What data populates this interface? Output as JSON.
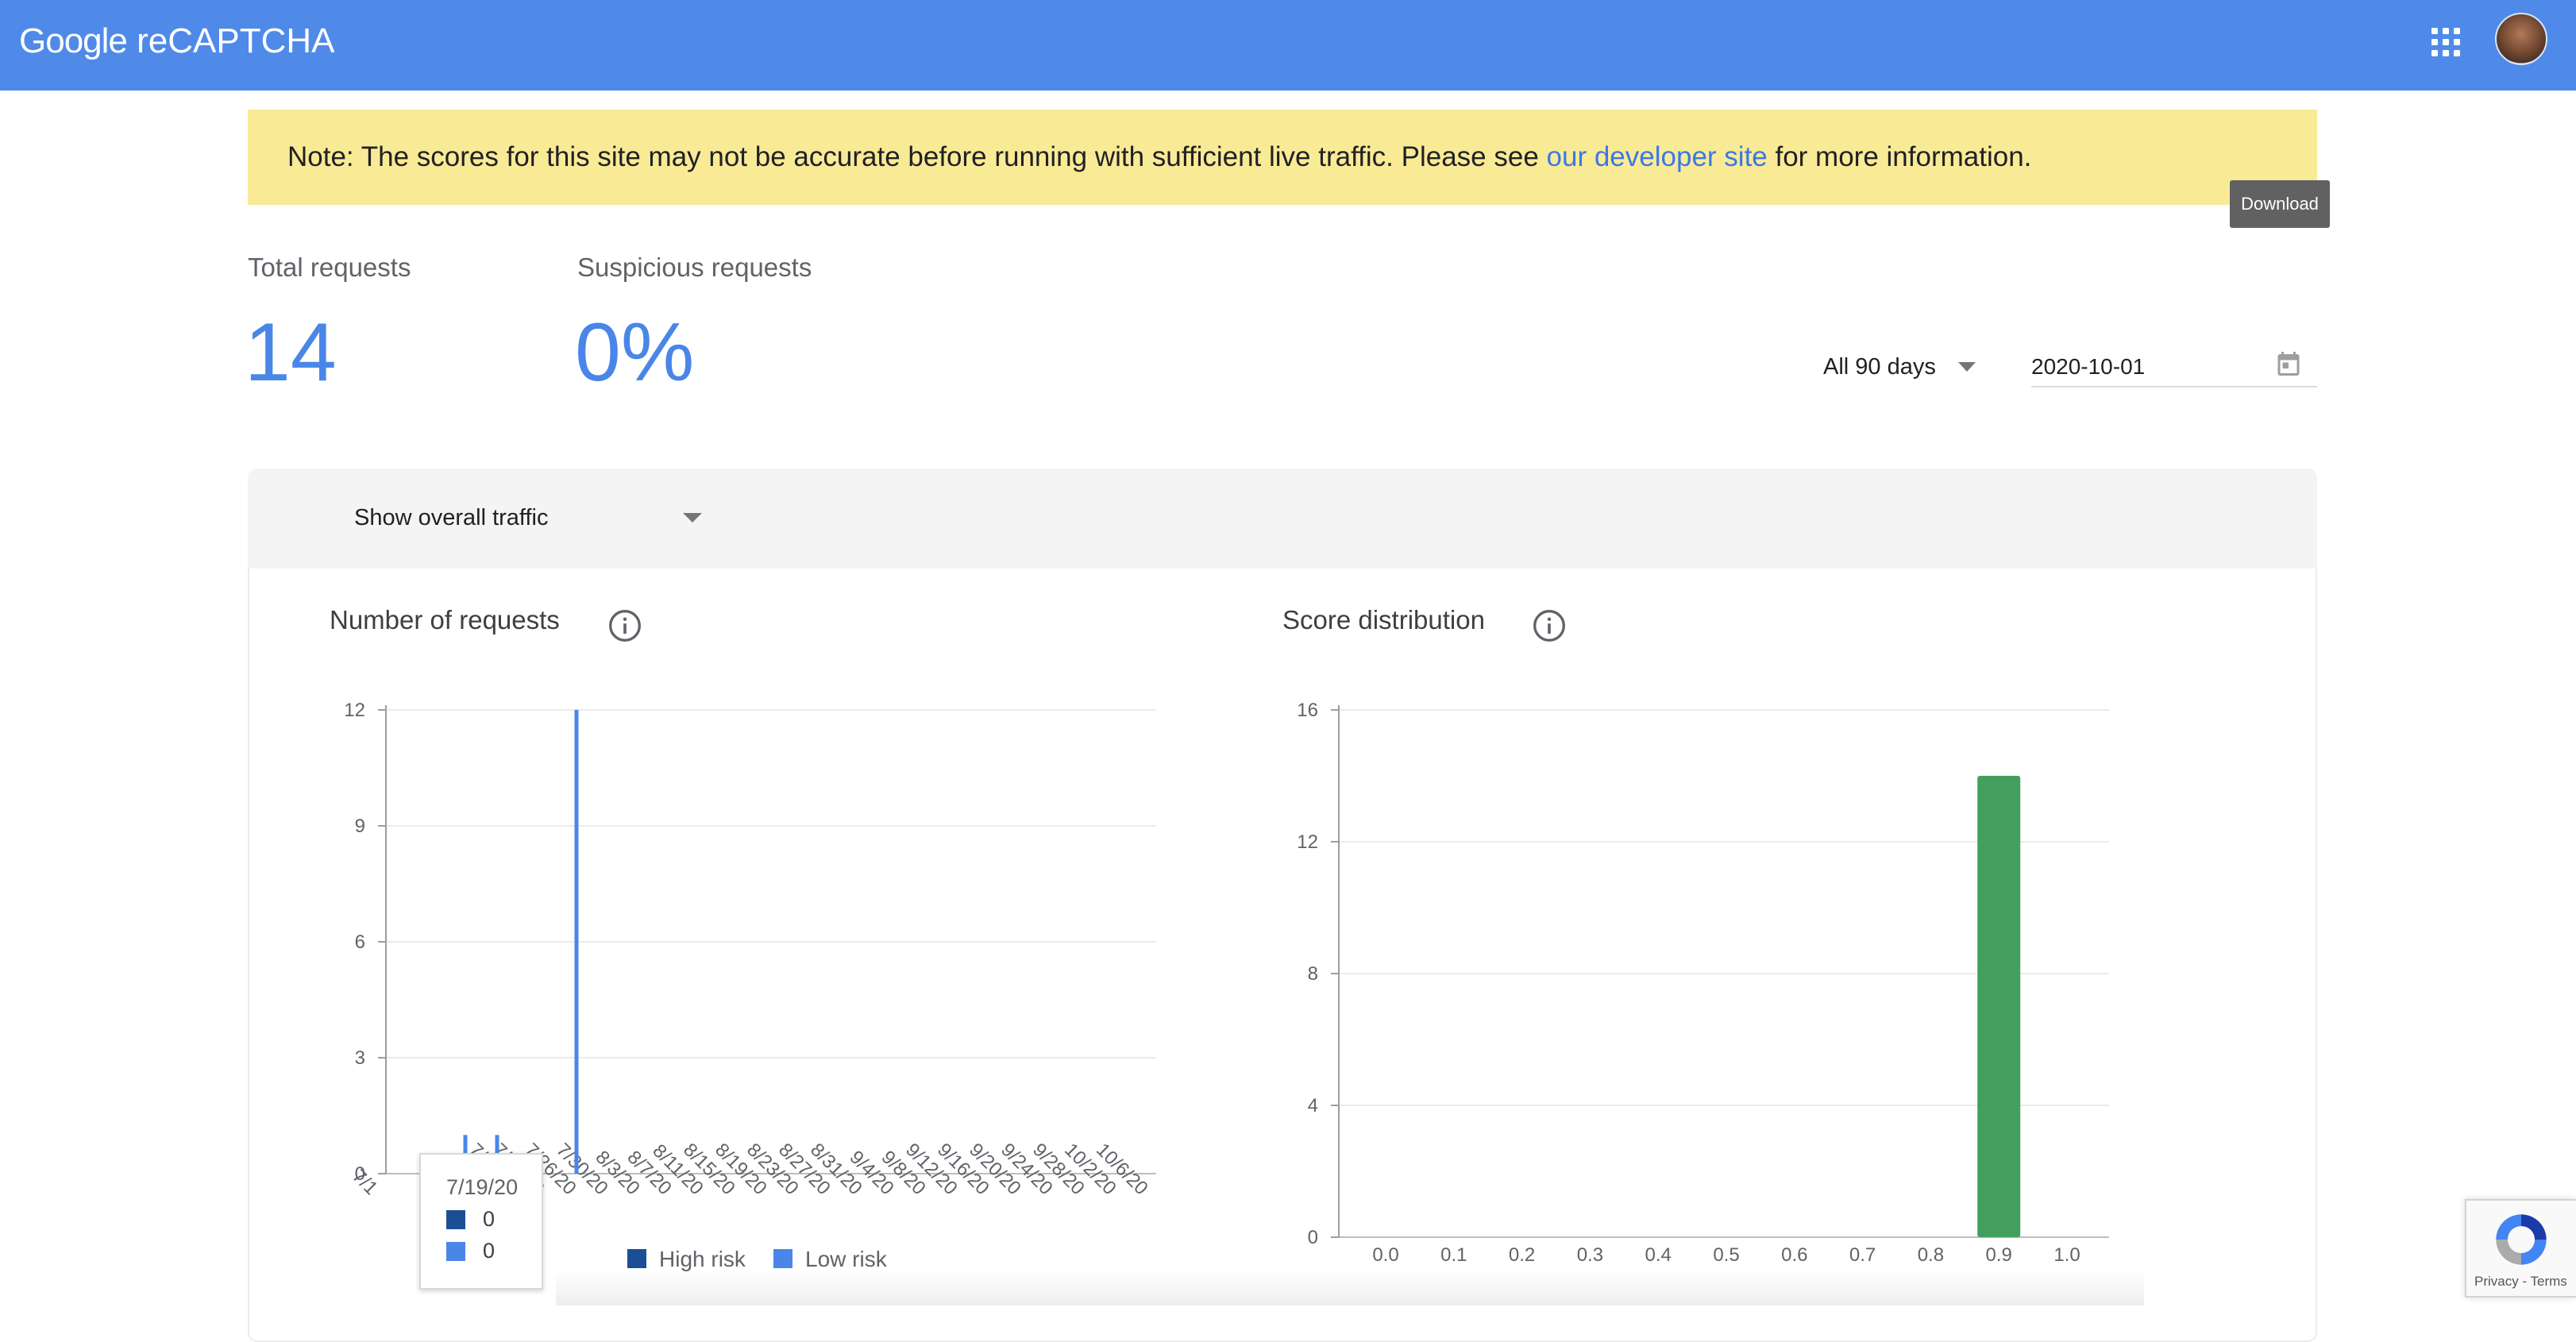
{
  "header": {
    "brand_google": "Google",
    "brand_product": "reCAPTCHA"
  },
  "note": {
    "prefix": "Note: The scores for this site may not be accurate before running with sufficient live traffic. Please see ",
    "link": "our developer site",
    "suffix": " for more information."
  },
  "download_tooltip": "Download",
  "stats": {
    "total_label": "Total requests",
    "total_value": "14",
    "suspicious_label": "Suspicious requests",
    "suspicious_value": "0%"
  },
  "filters": {
    "range": "All 90 days",
    "date": "2020-10-01"
  },
  "traffic_select": "Show overall traffic",
  "charts_titles": {
    "requests": "Number of requests",
    "score": "Score distribution"
  },
  "tooltip": {
    "date": "7/19/20",
    "high_risk": "0",
    "low_risk": "0"
  },
  "legend": {
    "high_risk": "High risk",
    "low_risk": "Low risk"
  },
  "badge": {
    "links": "Privacy - Terms"
  },
  "colors": {
    "brand": "#4f8ae9",
    "high_risk": "#1c4e95",
    "low_risk": "#4a86e8",
    "score_bar": "#449e5e",
    "note_bg": "#f9ea96"
  },
  "chart_data": [
    {
      "type": "bar",
      "title": "Number of requests",
      "ylim": [
        0,
        12
      ],
      "yticks": [
        0,
        3,
        6,
        9,
        12
      ],
      "categories": [
        "7/1",
        "7/19/20",
        "7/22/20",
        "7/26/20",
        "7/30/20",
        "8/3/20",
        "8/7/20",
        "8/11/20",
        "8/15/20",
        "8/19/20",
        "8/23/20",
        "8/27/20",
        "8/31/20",
        "9/4/20",
        "9/8/20",
        "9/12/20",
        "9/16/20",
        "9/20/20",
        "9/24/20",
        "9/28/20",
        "10/2/20",
        "10/6/20"
      ],
      "series": [
        {
          "name": "High risk",
          "color": "#1c4e95",
          "points": []
        },
        {
          "name": "Low risk",
          "color": "#4a86e8",
          "points": [
            {
              "x": "7/13/20",
              "y": 1
            },
            {
              "x": "7/17/20",
              "y": 1
            },
            {
              "x": "7/27/20",
              "y": 12
            }
          ]
        }
      ]
    },
    {
      "type": "bar",
      "title": "Score distribution",
      "categories": [
        "0.0",
        "0.1",
        "0.2",
        "0.3",
        "0.4",
        "0.5",
        "0.6",
        "0.7",
        "0.8",
        "0.9",
        "1.0"
      ],
      "values": [
        0,
        0,
        0,
        0,
        0,
        0,
        0,
        0,
        0,
        14,
        0
      ],
      "ylim": [
        0,
        16
      ],
      "yticks": [
        0,
        4,
        8,
        12,
        16
      ],
      "color": "#449e5e"
    }
  ]
}
